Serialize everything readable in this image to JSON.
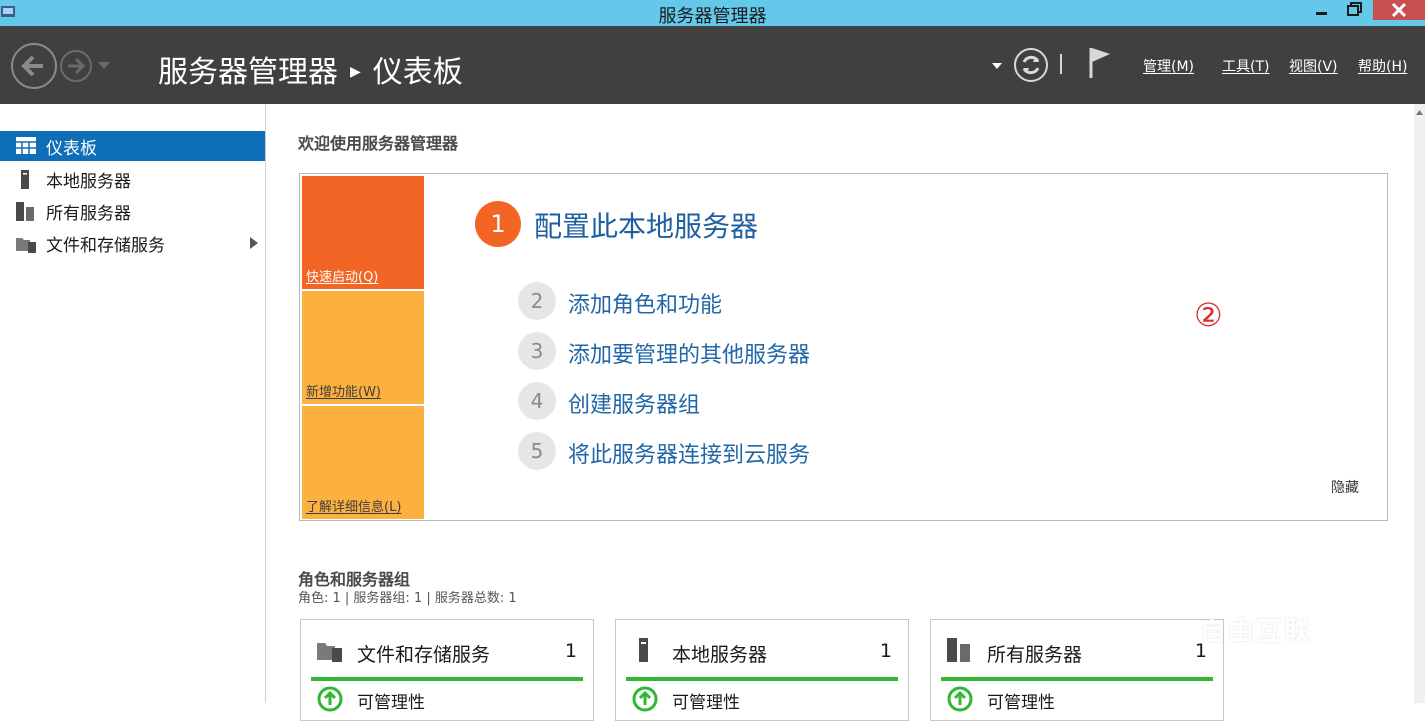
{
  "window": {
    "title": "服务器管理器"
  },
  "header": {
    "breadcrumb": {
      "root": "服务器管理器",
      "current": "仪表板"
    },
    "menus": [
      "管理(M)",
      "工具(T)",
      "视图(V)",
      "帮助(H)"
    ]
  },
  "sidebar": {
    "items": [
      {
        "label": "仪表板",
        "icon": "dashboard-icon",
        "selected": true
      },
      {
        "label": "本地服务器",
        "icon": "server-icon"
      },
      {
        "label": "所有服务器",
        "icon": "servers-icon"
      },
      {
        "label": "文件和存储服务",
        "icon": "folder-server-icon"
      }
    ]
  },
  "welcome": {
    "title": "欢迎使用服务器管理器",
    "tiles": [
      "快速启动(Q)",
      "新增功能(W)",
      "了解详细信息(L)"
    ],
    "steps": [
      {
        "num": "1",
        "label": "配置此本地服务器"
      },
      {
        "num": "2",
        "label": "添加角色和功能"
      },
      {
        "num": "3",
        "label": "添加要管理的其他服务器"
      },
      {
        "num": "4",
        "label": "创建服务器组"
      },
      {
        "num": "5",
        "label": "将此服务器连接到云服务"
      }
    ],
    "annotation": "②",
    "hide": "隐藏"
  },
  "roles": {
    "title": "角色和服务器组",
    "subtitle": "角色: 1 | 服务器组: 1 | 服务器总数: 1",
    "cards": [
      {
        "name": "文件和存储服务",
        "count": "1",
        "status": "可管理性"
      },
      {
        "name": "本地服务器",
        "count": "1",
        "status": "可管理性"
      },
      {
        "name": "所有服务器",
        "count": "1",
        "status": "可管理性"
      }
    ]
  },
  "watermark": "自由互联",
  "colors": {
    "accent": "#0e6eb8",
    "quickstart": "#f26524",
    "tile": "#fcb040",
    "ok": "#33b633",
    "titlebar": "#63c8ea"
  }
}
